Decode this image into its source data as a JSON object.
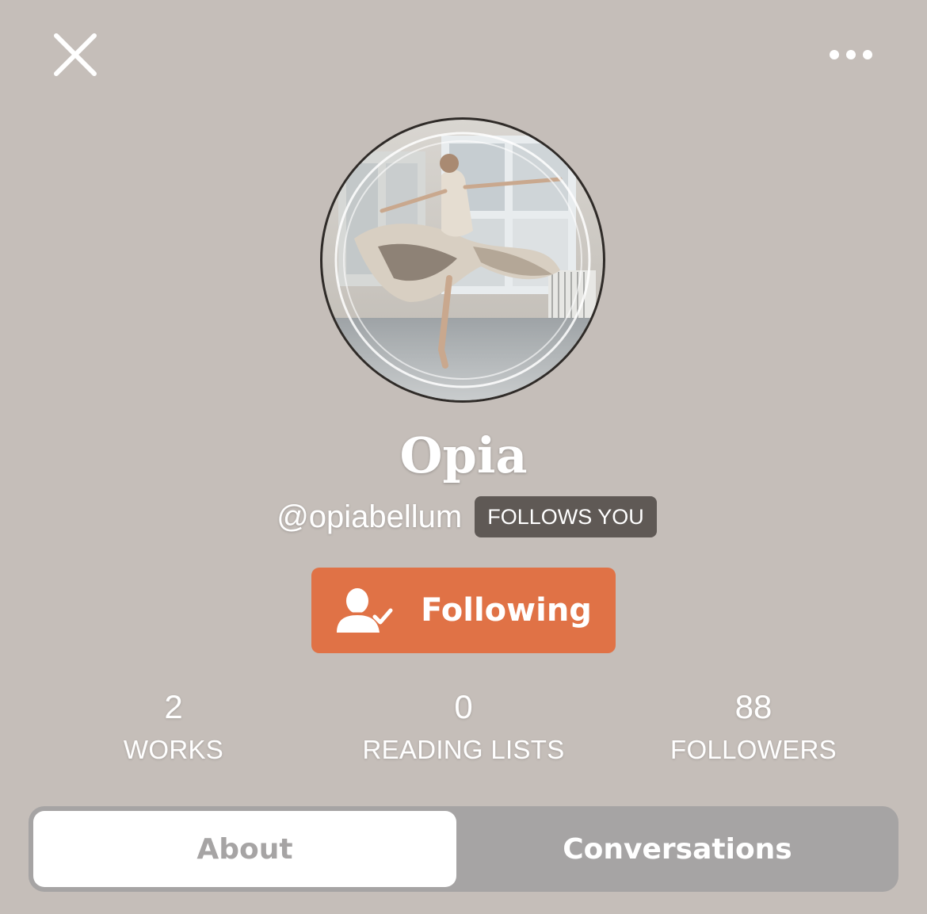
{
  "header": {
    "close_icon": "close-icon",
    "more_icon": "more-horizontal-icon"
  },
  "profile": {
    "display_name": "Opia",
    "handle": "@opiabellum",
    "follows_badge": "FOLLOWS YOU",
    "follow_button_label": "Following",
    "follow_button_icon": "user-check-icon"
  },
  "stats": [
    {
      "value": "2",
      "label": "WORKS"
    },
    {
      "value": "0",
      "label": "READING LISTS"
    },
    {
      "value": "88",
      "label": "FOLLOWERS"
    }
  ],
  "tabs": [
    {
      "label": "About",
      "active": true
    },
    {
      "label": "Conversations",
      "active": false
    }
  ],
  "colors": {
    "background": "#c5beb9",
    "accent": "#e07246",
    "badge": "#5f5955",
    "tab_bar": "#a6a4a4"
  }
}
